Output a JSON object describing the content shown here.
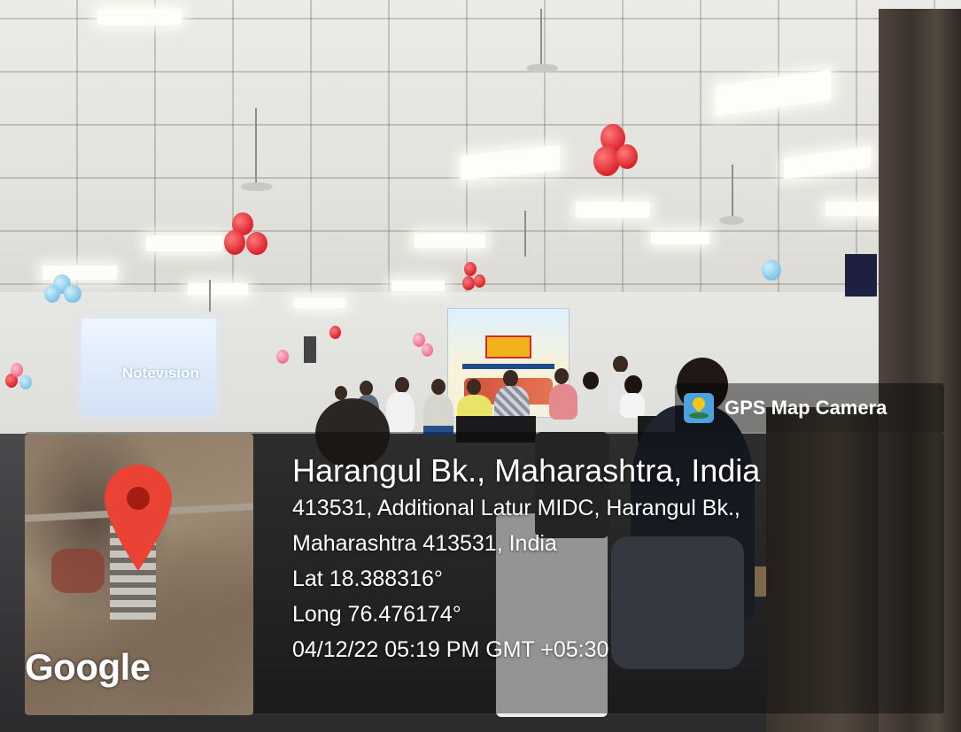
{
  "badge": {
    "icon": "gps-map-camera-icon",
    "label": "GPS Map Camera"
  },
  "map": {
    "logo": "Google",
    "pin_icon": "map-pin-icon"
  },
  "location": {
    "title": "Harangul Bk., Maharashtra, India",
    "address_line1": "413531, Additional Latur MIDC, Harangul Bk.,",
    "address_line2": "Maharashtra 413531, India",
    "lat": "Lat 18.388316°",
    "long": "Long 76.476174°",
    "datetime": "04/12/22 05:19 PM GMT +05:30"
  },
  "photo": {
    "screen_text": "Notevision",
    "colors": {
      "overlay": "#000000",
      "pin": "#ea4335",
      "text": "#ffffff"
    }
  }
}
